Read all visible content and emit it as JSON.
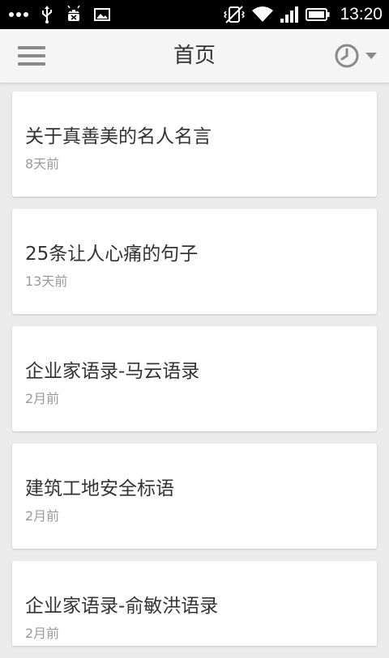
{
  "status_bar": {
    "time": "13:20",
    "icons": [
      "more-dots-icon",
      "usb-icon",
      "android-debug-icon",
      "image-icon",
      "vibrate-off-icon",
      "wifi-icon",
      "signal-icon",
      "battery-icon"
    ]
  },
  "header": {
    "title": "首页",
    "menu_icon": "hamburger-menu-icon",
    "history_icon": "clock-icon"
  },
  "articles": [
    {
      "title": "关于真善美的名人名言",
      "time": "8天前"
    },
    {
      "title": "25条让人心痛的句子",
      "time": "13天前"
    },
    {
      "title": "企业家语录-马云语录",
      "time": "2月前"
    },
    {
      "title": "建筑工地安全标语",
      "time": "2月前"
    },
    {
      "title": "企业家语录-俞敏洪语录",
      "time": "2月前"
    }
  ],
  "colors": {
    "status_bar_bg": "#000000",
    "app_bar_bg": "#f5f5f5",
    "page_bg": "#ececec",
    "card_bg": "#ffffff",
    "title_text": "#333333",
    "secondary_text": "#9a9a9a",
    "icon_gray": "#8a8a8a"
  }
}
